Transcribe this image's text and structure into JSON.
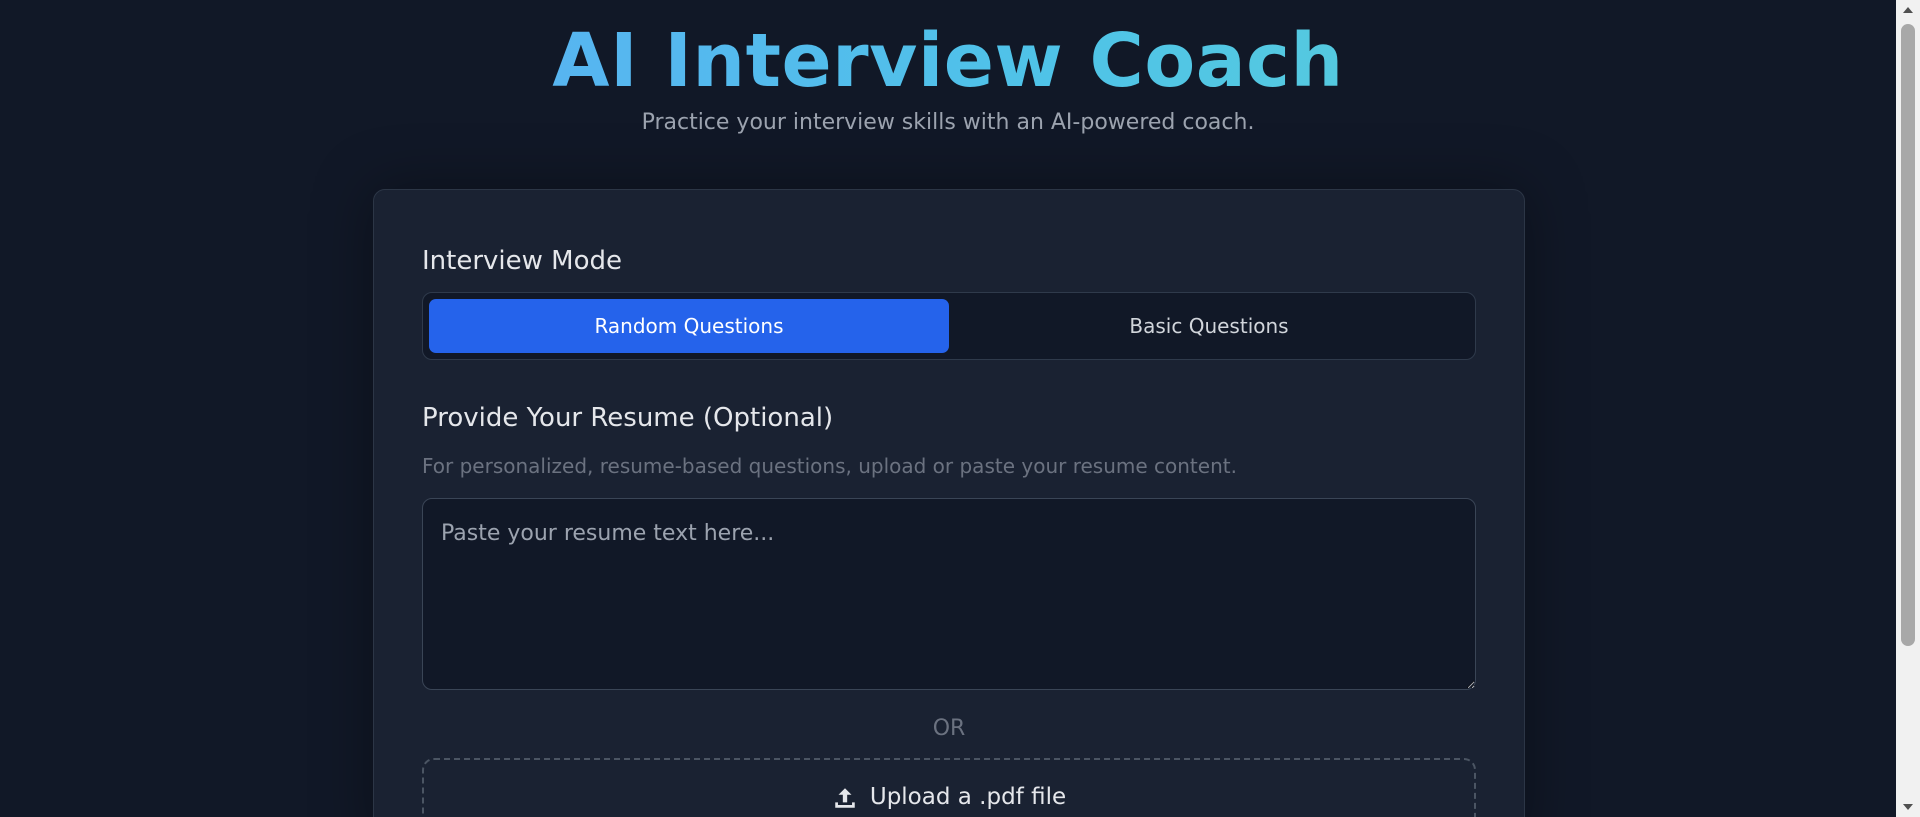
{
  "header": {
    "title": "AI Interview Coach",
    "subtitle": "Practice your interview skills with an AI-powered coach."
  },
  "interview_mode": {
    "heading": "Interview Mode",
    "options": [
      "Random Questions",
      "Basic Questions"
    ],
    "selected": "Random Questions"
  },
  "resume": {
    "heading": "Provide Your Resume (Optional)",
    "hint": "For personalized, resume-based questions, upload or paste your resume content.",
    "placeholder": "Paste your resume text here...",
    "value": "",
    "separator": "OR",
    "upload_label": "Upload a .pdf file",
    "upload_icon": "upload-icon"
  },
  "colors": {
    "background": "#111827",
    "card": "#1a2232",
    "accent": "#2563eb",
    "title_gradient_start": "#60a5fa",
    "title_gradient_end": "#5fd4d0"
  }
}
